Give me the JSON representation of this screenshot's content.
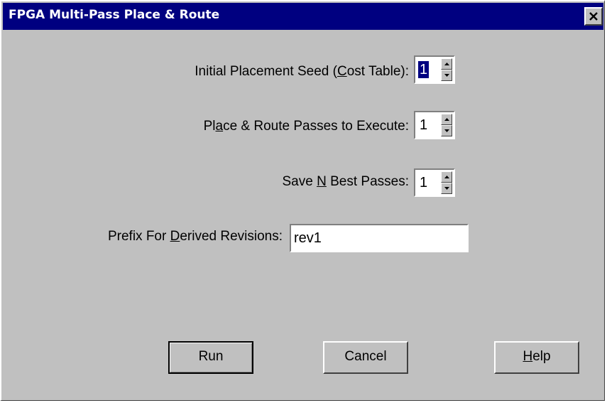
{
  "window": {
    "title": "FPGA Multi-Pass Place & Route",
    "close_glyph": "×"
  },
  "fields": {
    "seed": {
      "label_pre": "Initial Placement Seed (",
      "label_u": "C",
      "label_post": "ost Table):",
      "value": "1"
    },
    "passes": {
      "label_pre": "Pl",
      "label_u": "a",
      "label_post": "ce & Route Passes to Execute:",
      "value": "1"
    },
    "save_best": {
      "label_pre": "Save ",
      "label_u": "N",
      "label_post": " Best Passes:",
      "value": "1"
    },
    "prefix": {
      "label_pre": "Prefix For ",
      "label_u": "D",
      "label_post": "erived Revisions:",
      "value": "rev1"
    }
  },
  "buttons": {
    "run": "Run",
    "cancel": "Cancel",
    "help_u": "H",
    "help_post": "elp"
  },
  "icons": {
    "close": "close-icon",
    "spin_up": "triangle-up-icon",
    "spin_down": "triangle-down-icon"
  },
  "colors": {
    "titlebar": "#000080",
    "dialog_bg": "#c0c0c0",
    "selection": "#000080"
  }
}
